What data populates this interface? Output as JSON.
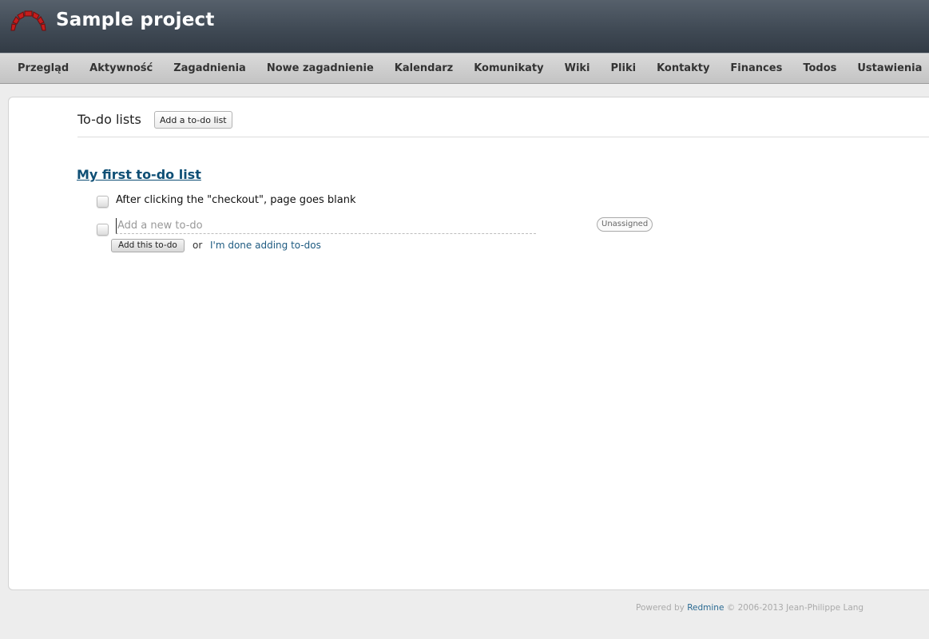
{
  "header": {
    "project_title": "Sample project",
    "logo_icon": "redmine-logo-icon"
  },
  "menu": {
    "items": [
      {
        "label": "Przegląd"
      },
      {
        "label": "Aktywność"
      },
      {
        "label": "Zagadnienia"
      },
      {
        "label": "Nowe zagadnienie"
      },
      {
        "label": "Kalendarz"
      },
      {
        "label": "Komunikaty"
      },
      {
        "label": "Wiki"
      },
      {
        "label": "Pliki"
      },
      {
        "label": "Kontakty"
      },
      {
        "label": "Finances"
      },
      {
        "label": "Todos"
      },
      {
        "label": "Ustawienia"
      }
    ]
  },
  "page": {
    "heading": "To-do lists",
    "add_list_label": "Add a to-do list"
  },
  "todo_list": {
    "title": "My first to-do list",
    "items": [
      {
        "text": "After clicking the \"checkout\", page goes blank"
      }
    ],
    "new_todo": {
      "placeholder": "Add a new to-do",
      "assignee": "Unassigned",
      "add_label": "Add this to-do",
      "or_text": "or",
      "done_label": "I'm done adding to-dos"
    }
  },
  "footer": {
    "prefix": "Powered by",
    "link": "Redmine",
    "suffix": "© 2006-2013 Jean-Philippe Lang"
  },
  "colors": {
    "link": "#0f4f75",
    "header_bg": "#404a55",
    "logo_red": "#c41d1d"
  }
}
